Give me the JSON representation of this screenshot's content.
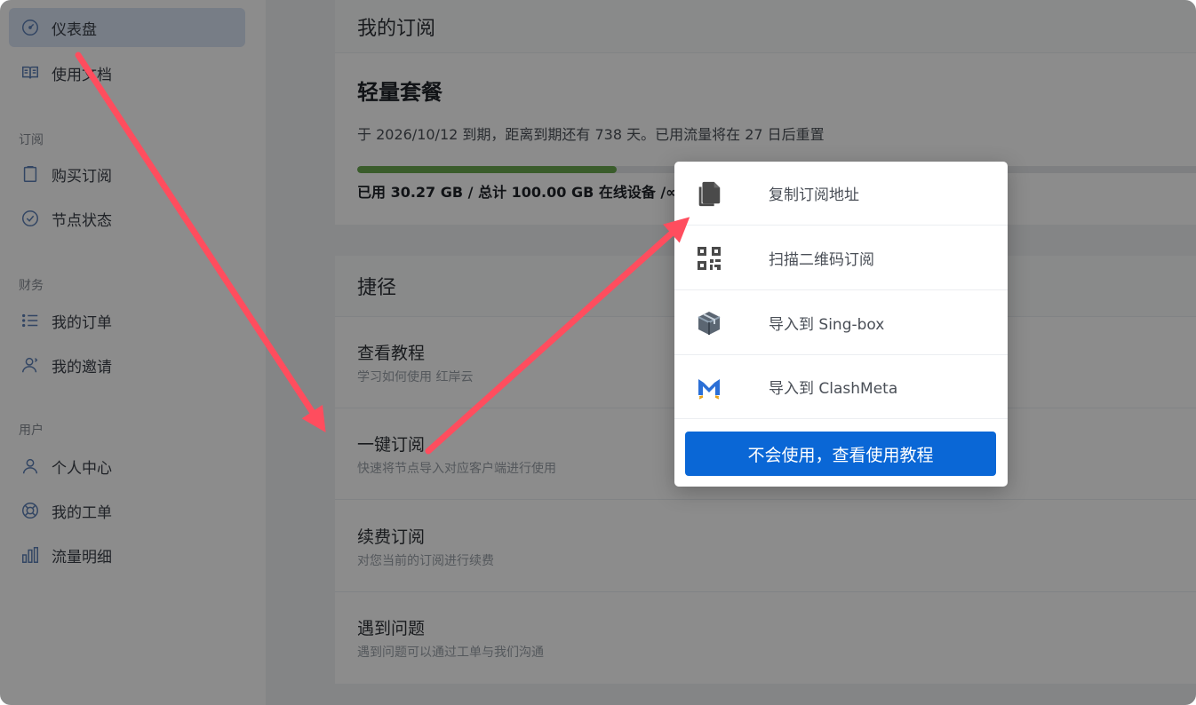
{
  "sidebar": {
    "items": [
      {
        "label": "仪表盘",
        "icon": "dashboard-icon",
        "active": true
      },
      {
        "label": "使用文档",
        "icon": "book-icon"
      },
      {
        "label": "购买订阅",
        "icon": "clipboard-icon"
      },
      {
        "label": "节点状态",
        "icon": "check-circle-icon"
      },
      {
        "label": "我的订单",
        "icon": "list-icon"
      },
      {
        "label": "我的邀请",
        "icon": "invite-user-icon"
      },
      {
        "label": "个人中心",
        "icon": "user-icon"
      },
      {
        "label": "我的工单",
        "icon": "lifebuoy-icon"
      },
      {
        "label": "流量明细",
        "icon": "bar-chart-icon"
      }
    ],
    "sections": [
      "订阅",
      "财务",
      "用户"
    ]
  },
  "subscription": {
    "header": "我的订阅",
    "plan_name": "轻量套餐",
    "description": "于 2026/10/12 到期，距离到期还有 738 天。已用流量将在 27 日后重置",
    "usage_fraction": 0.3027,
    "usage_text": "已用 30.27 GB / 总计 100.00 GB 在线设备 /∞"
  },
  "shortcuts": {
    "header": "捷径",
    "items": [
      {
        "title": "查看教程",
        "desc": "学习如何使用 红岸云"
      },
      {
        "title": "一键订阅",
        "desc": "快速将节点导入对应客户端进行使用"
      },
      {
        "title": "续费订阅",
        "desc": "对您当前的订阅进行续费"
      },
      {
        "title": "遇到问题",
        "desc": "遇到问题可以通过工单与我们沟通"
      }
    ]
  },
  "dropdown": {
    "items": [
      {
        "label": "复制订阅地址",
        "icon": "copy-icon"
      },
      {
        "label": "扫描二维码订阅",
        "icon": "qr-code-icon"
      },
      {
        "label": "导入到 Sing-box",
        "icon": "sing-box-icon"
      },
      {
        "label": "导入到 ClashMeta",
        "icon": "clashmeta-icon"
      }
    ],
    "button_label": "不会使用，查看使用教程"
  },
  "colors": {
    "accent": "#0a67d6",
    "progress": "#6aa84f",
    "arrow": "#ff4d5e",
    "sidebar_active": "#d9e4f5"
  }
}
